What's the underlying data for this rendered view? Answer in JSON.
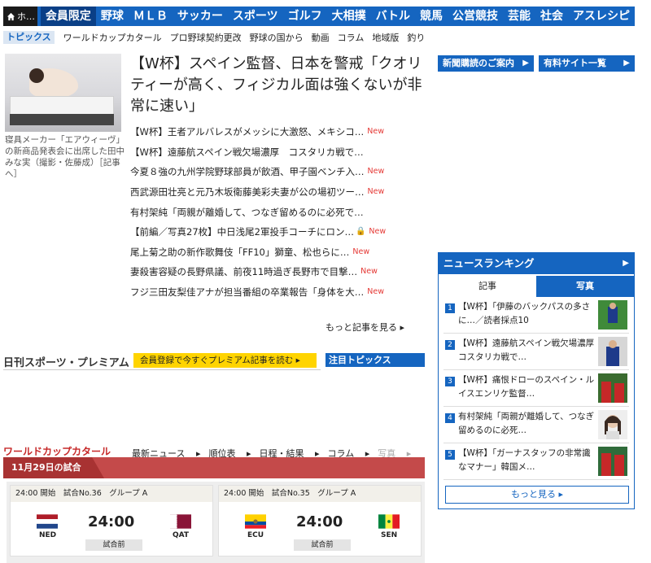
{
  "nav": {
    "home_label": "ホ…",
    "items": [
      "会員限定",
      "野球",
      "ＭＬＢ",
      "サッカー",
      "スポーツ",
      "ゴルフ",
      "大相撲",
      "バトル",
      "競馬",
      "公営競技",
      "芸能",
      "社会",
      "アスレシピ"
    ]
  },
  "subnav": {
    "tag": "トピックス",
    "links": [
      "ワールドカップカタール",
      "プロ野球契約更改",
      "野球の国から",
      "動画",
      "コラム",
      "地域版",
      "釣り"
    ]
  },
  "main": {
    "photo_caption": "寝具メーカー「エアウィーヴ」の新商品発表会に出席した田中みな実（撮影・佐藤成）［記事へ］",
    "headline": "【W杯】スペイン監督、日本を警戒「クオリティーが高く、フィジカル面は強くないが非常に速い」",
    "news": [
      {
        "text": "【W杯】王者アルバレスがメッシに大激怒、メキシコ…",
        "badge": "New",
        "lock": false
      },
      {
        "text": "【W杯】遠藤航スペイン戦欠場濃厚　コスタリカ戦で…",
        "badge": "",
        "lock": false
      },
      {
        "text": "今夏８強の九州学院野球部員が飲酒、甲子園ベンチ入…",
        "badge": "New",
        "lock": false
      },
      {
        "text": "西武源田壮亮と元乃木坂衛藤美彩夫妻が公の場初ツー…",
        "badge": "New",
        "lock": false
      },
      {
        "text": "有村架純「両親が離婚して、つなぎ留めるのに必死で…",
        "badge": "",
        "lock": false
      },
      {
        "text": "【前編／写真27枚】中日浅尾2軍投手コーチにロン…",
        "badge": "New",
        "lock": true
      },
      {
        "text": "尾上菊之助の新作歌舞伎「FF10」獅童、松也らに…",
        "badge": "New",
        "lock": false
      },
      {
        "text": "妻殺害容疑の長野県議、前夜11時過ぎ長野市で目撃…",
        "badge": "New",
        "lock": false
      },
      {
        "text": "フジ三田友梨佳アナが担当番組の卒業報告「身体を大…",
        "badge": "New",
        "lock": false
      }
    ],
    "more_label": "もっと記事を見る"
  },
  "premium": {
    "title": "日刊スポーツ・プレミアム",
    "signup_label": "会員登録で今すぐプレミアム記事を読む",
    "topics_label": "注目トピックス"
  },
  "worldcup": {
    "title": "ワールドカップカタール",
    "tabs": [
      "最新ニュース",
      "順位表",
      "日程・結果",
      "コラム",
      "写真"
    ],
    "date_label": "11月29日の試合",
    "matches": [
      {
        "info": "24:00 開始　試合No.36　グループ A",
        "home": "NED",
        "away": "QAT",
        "time": "24:00",
        "status": "試合前"
      },
      {
        "info": "24:00 開始　試合No.35　グループ A",
        "home": "ECU",
        "away": "SEN",
        "time": "24:00",
        "status": "試合前"
      }
    ]
  },
  "sidebar": {
    "btn1": "新聞購読のご案内",
    "btn2": "有料サイト一覧",
    "ranking_title": "ニュースランキング",
    "tab_articles": "記事",
    "tab_photos": "写真",
    "ranking": [
      {
        "num": "1",
        "text": "【W杯】「伊藤のバックパスの多さに…／読者採点10"
      },
      {
        "num": "2",
        "text": "【W杯】遠藤航スペイン戦欠場濃厚　コスタリカ戦で…"
      },
      {
        "num": "3",
        "text": "【W杯】痛恨ドローのスペイン・ルイスエンリケ監督…"
      },
      {
        "num": "4",
        "text": "有村架純「両親が離婚して、つなぎ留めるのに必死…"
      },
      {
        "num": "5",
        "text": "【W杯】「ガーナスタッフの非常識なマナー」韓国メ…"
      }
    ],
    "more_label": "もっと見る"
  },
  "colors": {
    "brand": "#1565c0",
    "accent_red": "#c62828",
    "new_badge": "#e53935",
    "premium_yellow": "#ffd400"
  }
}
